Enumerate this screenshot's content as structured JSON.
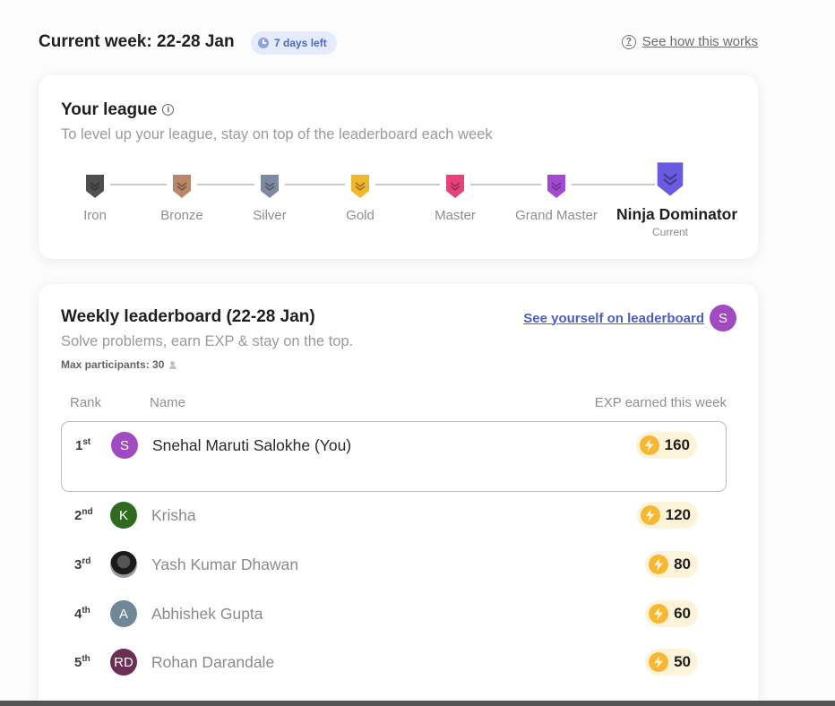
{
  "header": {
    "week_title": "Current week: 22-28 Jan",
    "days_left": "7 days left",
    "help_link": "See how this works",
    "help_icon": "question-circle-icon"
  },
  "league": {
    "title": "Your league",
    "subtitle": "To level up your league, stay on top of the leaderboard each week",
    "current_tag": "Current",
    "tiers": [
      {
        "label": "Iron",
        "color": "#4f4f4f",
        "icon": "iron-shield-icon"
      },
      {
        "label": "Bronze",
        "color": "#b88868",
        "icon": "bronze-shield-icon"
      },
      {
        "label": "Silver",
        "color": "#7e8aa3",
        "icon": "silver-shield-icon"
      },
      {
        "label": "Gold",
        "color": "#f0b62c",
        "icon": "gold-shield-icon"
      },
      {
        "label": "Master",
        "color": "#e8427a",
        "icon": "master-shield-icon"
      },
      {
        "label": "Grand Master",
        "color": "#a24ad4",
        "icon": "grand-master-shield-icon"
      },
      {
        "label": "Ninja Dominator",
        "color": "#6a5ae0",
        "icon": "ninja-dominator-shield-icon",
        "current": true
      }
    ]
  },
  "leaderboard": {
    "title": "Weekly leaderboard (22-28 Jan)",
    "subtitle": "Solve problems, earn EXP & stay on the top.",
    "max_participants": "Max participants: 30",
    "see_yourself": "See yourself on leaderboard",
    "self_avatar": "S",
    "columns": {
      "rank": "Rank",
      "name": "Name",
      "exp": "EXP earned this week"
    },
    "rows": [
      {
        "rank": "1",
        "suffix": "st",
        "avatar": "S",
        "avatar_color": "#a24ac2",
        "name": "Snehal Maruti Salokhe (You)",
        "exp": "160",
        "you": true
      },
      {
        "rank": "2",
        "suffix": "nd",
        "avatar": "K",
        "avatar_color": "#2e6b1f",
        "name": "Krisha",
        "exp": "120"
      },
      {
        "rank": "3",
        "suffix": "rd",
        "avatar": "",
        "avatar_color": "#1a1a1a",
        "name": "Yash Kumar Dhawan",
        "exp": "80",
        "photo": true
      },
      {
        "rank": "4",
        "suffix": "th",
        "avatar": "A",
        "avatar_color": "#6f8796",
        "name": "Abhishek Gupta",
        "exp": "60"
      },
      {
        "rank": "5",
        "suffix": "th",
        "avatar": "RD",
        "avatar_color": "#6b2f55",
        "name": "Rohan Darandale",
        "exp": "50"
      }
    ]
  }
}
